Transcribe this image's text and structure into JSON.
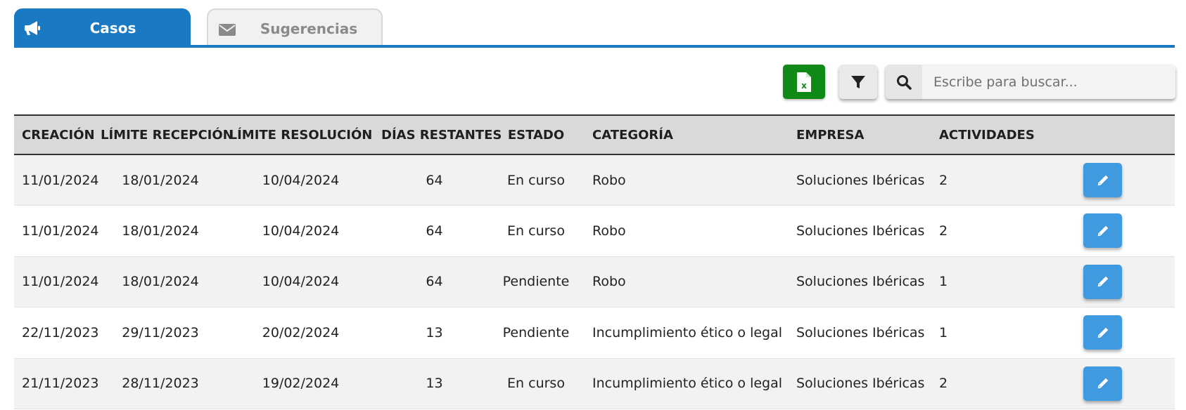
{
  "tabs": [
    {
      "label": "Casos",
      "icon": "megaphone-icon",
      "active": true
    },
    {
      "label": "Sugerencias",
      "icon": "envelope-icon",
      "active": false
    }
  ],
  "toolbar": {
    "excel_icon": "excel-export-icon",
    "filter_icon": "filter-icon",
    "search_icon": "search-icon",
    "search_placeholder": "Escribe para buscar...",
    "search_value": ""
  },
  "table": {
    "headers": {
      "creacion": "CREACIÓN",
      "limite_recepcion": "LÍMITE RECEPCIÓN",
      "limite_resolucion": "LÍMITE RESOLUCIÓN",
      "dias_restantes": "DÍAS RESTANTES",
      "estado": "ESTADO",
      "categoria": "CATEGORÍA",
      "empresa": "EMPRESA",
      "actividades": "ACTIVIDADES"
    },
    "rows": [
      {
        "creacion": "11/01/2024",
        "limite_recepcion": "18/01/2024",
        "limite_resolucion": "10/04/2024",
        "dias_restantes": "64",
        "estado": "En curso",
        "categoria": "Robo",
        "empresa": "Soluciones Ibéricas",
        "actividades": "2"
      },
      {
        "creacion": "11/01/2024",
        "limite_recepcion": "18/01/2024",
        "limite_resolucion": "10/04/2024",
        "dias_restantes": "64",
        "estado": "En curso",
        "categoria": "Robo",
        "empresa": "Soluciones Ibéricas",
        "actividades": "2"
      },
      {
        "creacion": "11/01/2024",
        "limite_recepcion": "18/01/2024",
        "limite_resolucion": "10/04/2024",
        "dias_restantes": "64",
        "estado": "Pendiente",
        "categoria": "Robo",
        "empresa": "Soluciones Ibéricas",
        "actividades": "1"
      },
      {
        "creacion": "22/11/2023",
        "limite_recepcion": "29/11/2023",
        "limite_resolucion": "20/02/2024",
        "dias_restantes": "13",
        "estado": "Pendiente",
        "categoria": "Incumplimiento ético o legal",
        "empresa": "Soluciones Ibéricas",
        "actividades": "1"
      },
      {
        "creacion": "21/11/2023",
        "limite_recepcion": "28/11/2023",
        "limite_resolucion": "19/02/2024",
        "dias_restantes": "13",
        "estado": "En curso",
        "categoria": "Incumplimiento ético o legal",
        "empresa": "Soluciones Ibéricas",
        "actividades": "2"
      }
    ],
    "row_action_icon": "pencil-icon"
  },
  "colors": {
    "primary": "#1979c3",
    "excel_green": "#0f8a16",
    "edit_button": "#3f9ae0",
    "header_bg": "#d9d9d9"
  }
}
